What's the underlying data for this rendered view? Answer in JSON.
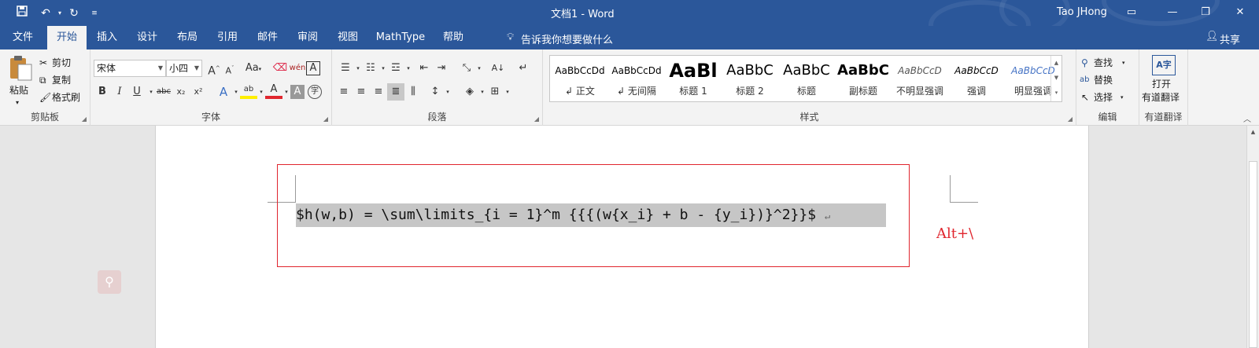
{
  "window": {
    "title": "文档1  -  Word",
    "user": "Tao JHong",
    "qa_icons": [
      "save-icon",
      "undo-icon",
      "redo-icon",
      "customize-icon"
    ]
  },
  "tabs": [
    {
      "label": "文件"
    },
    {
      "label": "开始",
      "active": true
    },
    {
      "label": "插入"
    },
    {
      "label": "设计"
    },
    {
      "label": "布局"
    },
    {
      "label": "引用"
    },
    {
      "label": "邮件"
    },
    {
      "label": "审阅"
    },
    {
      "label": "视图"
    },
    {
      "label": "MathType"
    },
    {
      "label": "帮助"
    }
  ],
  "tell_me": "告诉我你想要做什么",
  "share": "共享",
  "clipboard": {
    "paste": "粘贴",
    "cut": "剪切",
    "copy": "复制",
    "format_painter": "格式刷",
    "label": "剪贴板"
  },
  "font": {
    "name": "宋体",
    "size": "小四",
    "label": "字体",
    "grow": "A",
    "shrink": "A",
    "case": "Aa",
    "phonetic": "wén",
    "border_char": "A",
    "bold": "B",
    "italic": "I",
    "underline": "U",
    "strike": "abc",
    "subscript": "x₂",
    "superscript": "x²",
    "effects": "A",
    "highlight": "ab",
    "font_color": "A",
    "shading": "A",
    "enclose": "字"
  },
  "paragraph": {
    "label": "段落"
  },
  "styles": {
    "label": "样式",
    "items": [
      {
        "preview": "AaBbCcDd",
        "name": "正文"
      },
      {
        "preview": "AaBbCcDd",
        "name": "无间隔"
      },
      {
        "preview": "AaBl",
        "name": "标题 1"
      },
      {
        "preview": "AaBbC",
        "name": "标题 2"
      },
      {
        "preview": "AaBbC",
        "name": "标题"
      },
      {
        "preview": "AaBbC",
        "name": "副标题"
      },
      {
        "preview": "AaBbCcD",
        "name": "不明显强调"
      },
      {
        "preview": "AaBbCcD",
        "name": "强调"
      },
      {
        "preview": "AaBbCcD",
        "name": "明显强调"
      }
    ]
  },
  "editing": {
    "find": "查找",
    "replace": "替换",
    "select": "选择",
    "label": "编辑"
  },
  "youdao": {
    "line1": "打开",
    "line2": "有道翻译",
    "label": "有道翻译"
  },
  "document": {
    "equation": "$h(w,b) = \\sum\\limits_{i = 1}^m {{{(w{x_i} + b - {y_i})}^2}}$",
    "paragraph_mark": "↵",
    "shortcut": "Alt+\\"
  },
  "colors": {
    "accent": "#2b579a",
    "annotation": "#e0262e"
  }
}
